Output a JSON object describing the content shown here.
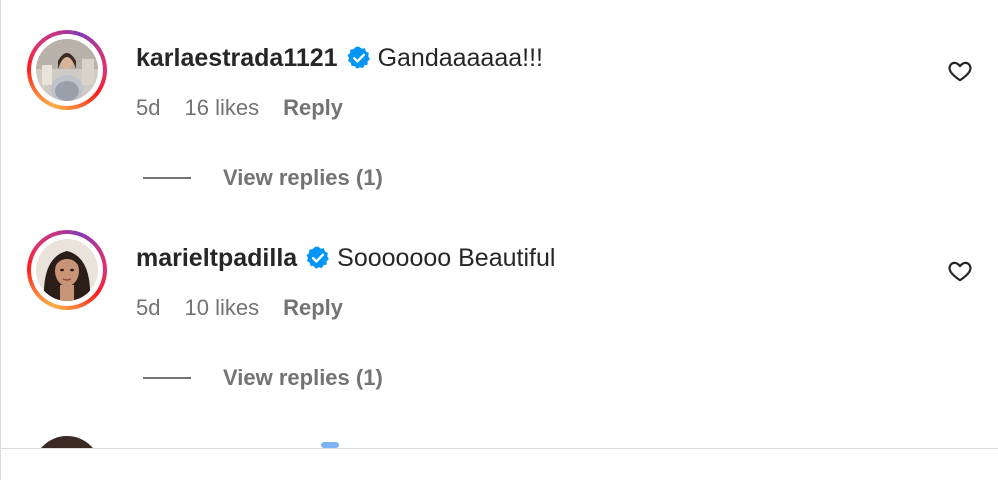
{
  "colors": {
    "username": "#262626",
    "secondary_text": "#737373",
    "verified_blue": "#0095f6",
    "divider": "#dbdbdb",
    "story_ring": [
      "#fcaf45",
      "#f77737",
      "#fd1d1d",
      "#e1306c",
      "#c13584",
      "#833ab4"
    ]
  },
  "comments": [
    {
      "username": "karlaestrada1121",
      "verified": true,
      "text": "Gandaaaaaa!!!",
      "time": "5d",
      "likes": "16 likes",
      "reply_label": "Reply",
      "view_replies_label": "View replies (1)",
      "like_icon": "heart-outline-icon",
      "avatar_icon": "avatar"
    },
    {
      "username": "marieltpadilla",
      "verified": true,
      "text": "Sooooooo Beautiful",
      "time": "5d",
      "likes": "10 likes",
      "reply_label": "Reply",
      "view_replies_label": "View replies (1)",
      "like_icon": "heart-outline-icon",
      "avatar_icon": "avatar"
    }
  ]
}
